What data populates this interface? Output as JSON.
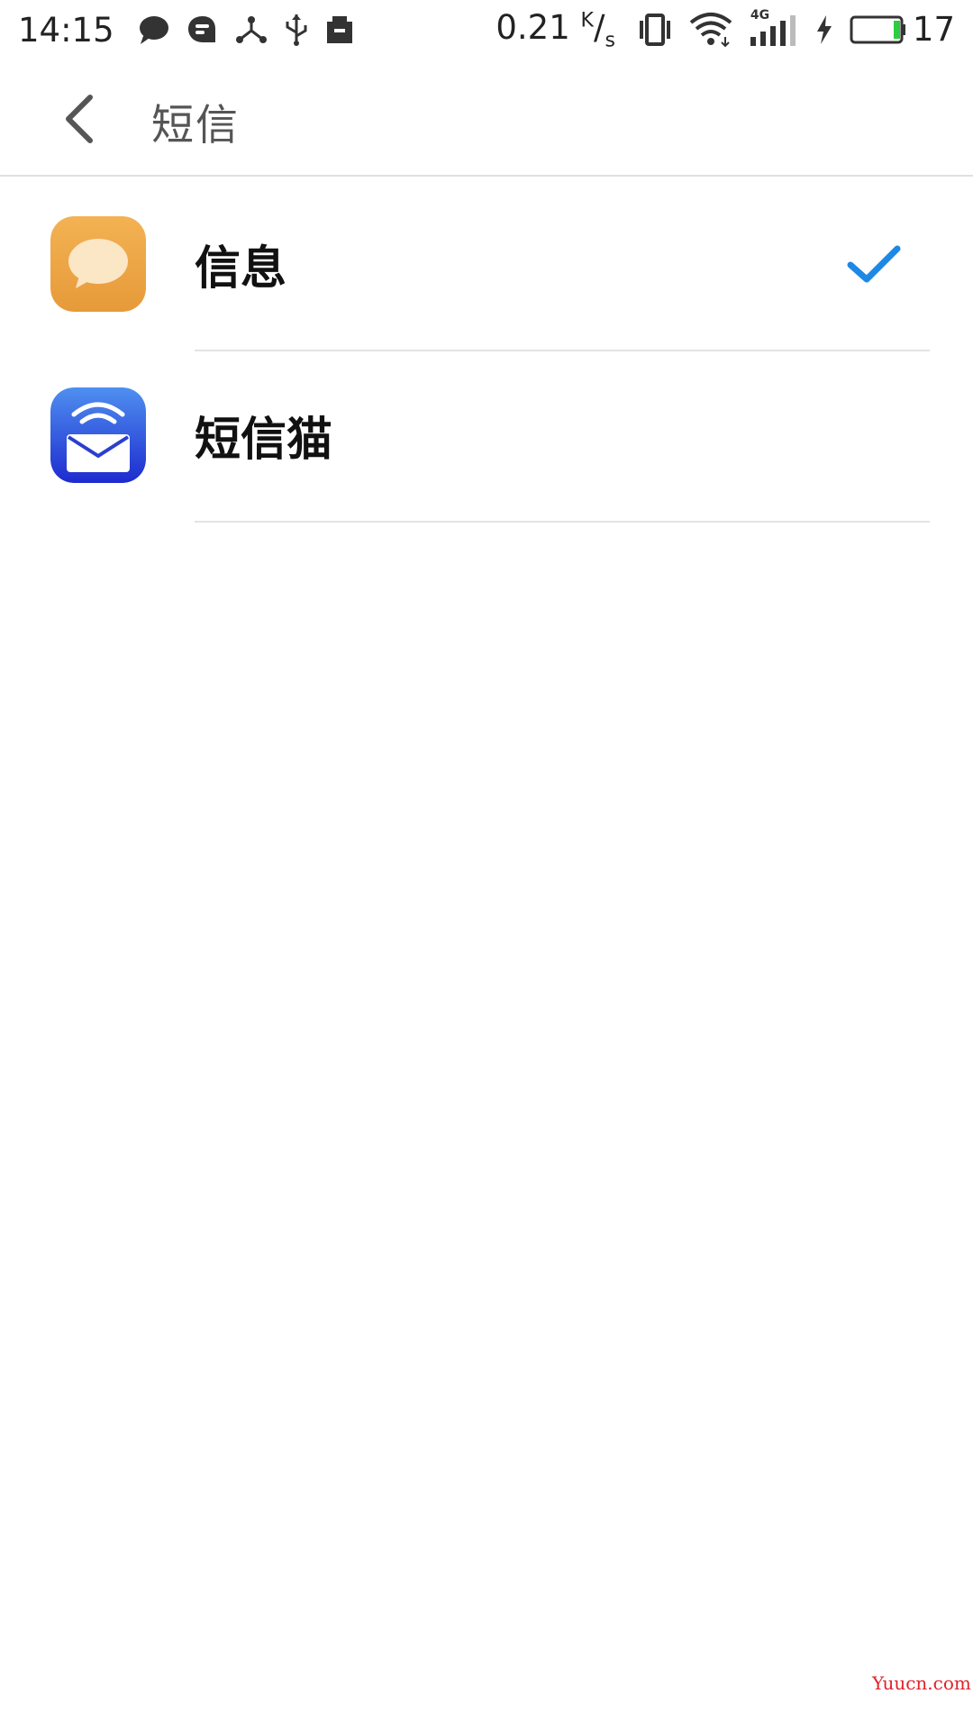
{
  "status_bar": {
    "time": "14:15",
    "net_speed_value": "0.21",
    "net_speed_unit_top": "K",
    "net_speed_unit_bottom": "s",
    "network_type": "4G",
    "battery_percent": "17",
    "icons": [
      "chat-bubble-icon",
      "message-app-icon",
      "share-icon",
      "usb-icon",
      "clipboard-icon",
      "vibrate-icon",
      "wifi-icon",
      "signal-icon",
      "charging-icon",
      "battery-icon"
    ],
    "battery_level_color": "#2ecc40"
  },
  "toolbar": {
    "title": "短信",
    "back_icon": "chevron-left-icon"
  },
  "apps": [
    {
      "label": "信息",
      "icon": "message-bubble-icon",
      "selected": true
    },
    {
      "label": "短信猫",
      "icon": "envelope-wifi-icon",
      "selected": false
    }
  ],
  "colors": {
    "accent": "#1e88e5",
    "divider": "#e3e3e3",
    "info_icon_orange": "#f0a63e",
    "cat_icon_blue": "#2545d6"
  },
  "watermark": "Yuucn.com"
}
